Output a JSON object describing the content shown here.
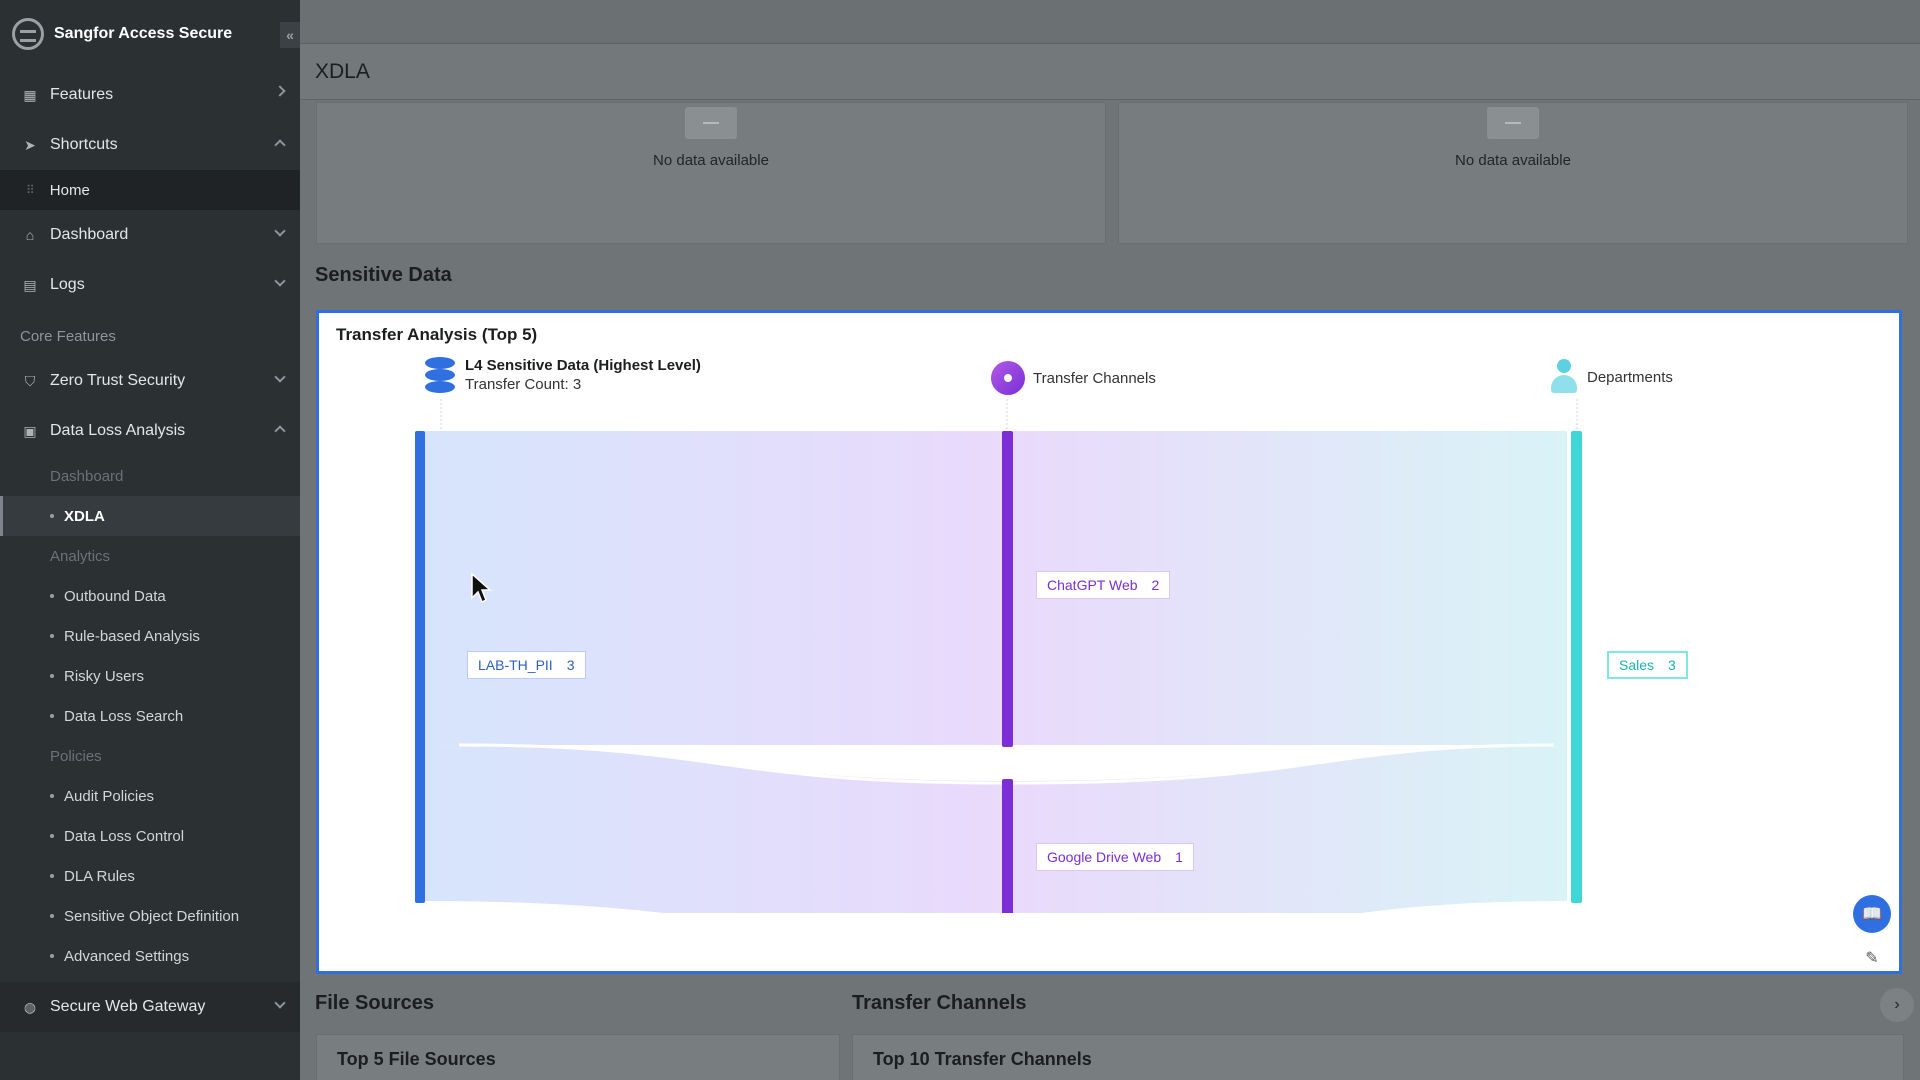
{
  "app": {
    "title": "Sangfor Access Secure"
  },
  "sidebar": {
    "features": "Features",
    "shortcuts": "Shortcuts",
    "home": "Home",
    "dashboard": "Dashboard",
    "logs": "Logs",
    "core_features": "Core Features",
    "zero_trust": "Zero Trust Security",
    "data_loss_analysis": "Data Loss Analysis",
    "dla_dashboard": "Dashboard",
    "xdla": "XDLA",
    "analytics": "Analytics",
    "outbound_data": "Outbound Data",
    "rule_based": "Rule-based Analysis",
    "risky_users": "Risky Users",
    "data_loss_search": "Data Loss Search",
    "policies": "Policies",
    "audit_policies": "Audit Policies",
    "data_loss_control": "Data Loss Control",
    "dla_rules": "DLA Rules",
    "sensitive_object_definition": "Sensitive Object Definition",
    "advanced_settings": "Advanced Settings",
    "secure_web_gateway": "Secure Web Gateway"
  },
  "header": {
    "title": "XDLA"
  },
  "panels": {
    "left_nodata": "No data available",
    "right_nodata": "No data available"
  },
  "sensitive_section": {
    "title": "Sensitive Data"
  },
  "sankey": {
    "title": "Transfer Analysis (Top 5)",
    "col1_title": "L4 Sensitive Data (Highest Level)",
    "col1_sub": "Transfer Count: 3",
    "col2_title": "Transfer Channels",
    "col3_title": "Departments",
    "nodes": {
      "source": {
        "name": "LAB-TH_PII",
        "value": "3"
      },
      "chatgpt": {
        "name": "ChatGPT Web",
        "value": "2"
      },
      "gdrive": {
        "name": "Google Drive Web",
        "value": "1"
      },
      "sales": {
        "name": "Sales",
        "value": "3"
      }
    },
    "colors": {
      "source": "#2f6fe0",
      "channel": "#7b2ed6",
      "department": "#3ed6d6"
    }
  },
  "bottom": {
    "file_sources_title": "File Sources",
    "transfer_channels_title": "Transfer Channels",
    "top5_file_sources": "Top 5 File Sources",
    "top10_channels": "Top 10 Transfer Channels"
  }
}
